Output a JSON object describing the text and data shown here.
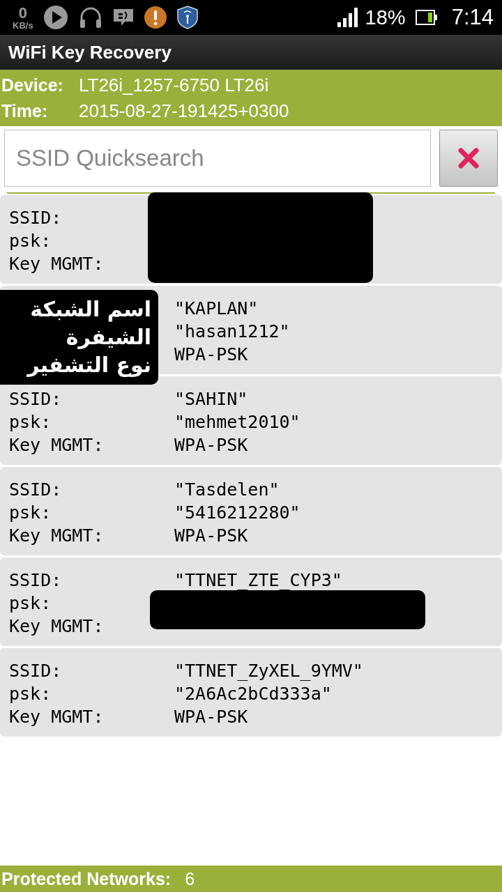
{
  "status_bar": {
    "speed_value": "0",
    "speed_unit": "KB/s",
    "battery": "18%",
    "time": "7:14"
  },
  "window": {
    "title": "WiFi Key Recovery"
  },
  "device_info": [
    {
      "label": "Device:",
      "value": "LT26i_1257-6750 LT26i"
    },
    {
      "label": "Time:",
      "value": "2015-08-27-191425+0300"
    }
  ],
  "search": {
    "placeholder": "SSID Quicksearch"
  },
  "networks": [
    {
      "labels": [
        "SSID:",
        "psk:",
        "Key MGMT:"
      ],
      "values_redacted": true,
      "psk_redacted": false
    },
    {
      "values": [
        "\"KAPLAN\"",
        "\"hasan1212\"",
        "WPA-PSK"
      ],
      "values_redacted": false,
      "psk_redacted": false,
      "annotation": [
        "اسم الشبكة",
        "الشيفرة",
        "نوع التشفير"
      ]
    },
    {
      "labels": [
        "SSID:",
        "psk:",
        "Key MGMT:"
      ],
      "values": [
        "\"SAHIN\"",
        "\"mehmet2010\"",
        "WPA-PSK"
      ],
      "values_redacted": false,
      "psk_redacted": false
    },
    {
      "labels": [
        "SSID:",
        "psk:",
        "Key MGMT:"
      ],
      "values": [
        "\"Tasdelen\"",
        "\"5416212280\"",
        "WPA-PSK"
      ],
      "values_redacted": false,
      "psk_redacted": false
    },
    {
      "labels": [
        "SSID:",
        "psk:",
        "Key MGMT:"
      ],
      "values": [
        "\"TTNET_ZTE_CYP3\""
      ],
      "values_redacted": false,
      "psk_redacted": true
    },
    {
      "labels": [
        "SSID:",
        "psk:",
        "Key MGMT:"
      ],
      "values": [
        "\"TTNET_ZyXEL_9YMV\"",
        "\"2A6Ac2bCd333a\"",
        "WPA-PSK"
      ],
      "values_redacted": false,
      "psk_redacted": false
    }
  ],
  "footer": {
    "label": "Protected Networks:",
    "count": "6"
  }
}
